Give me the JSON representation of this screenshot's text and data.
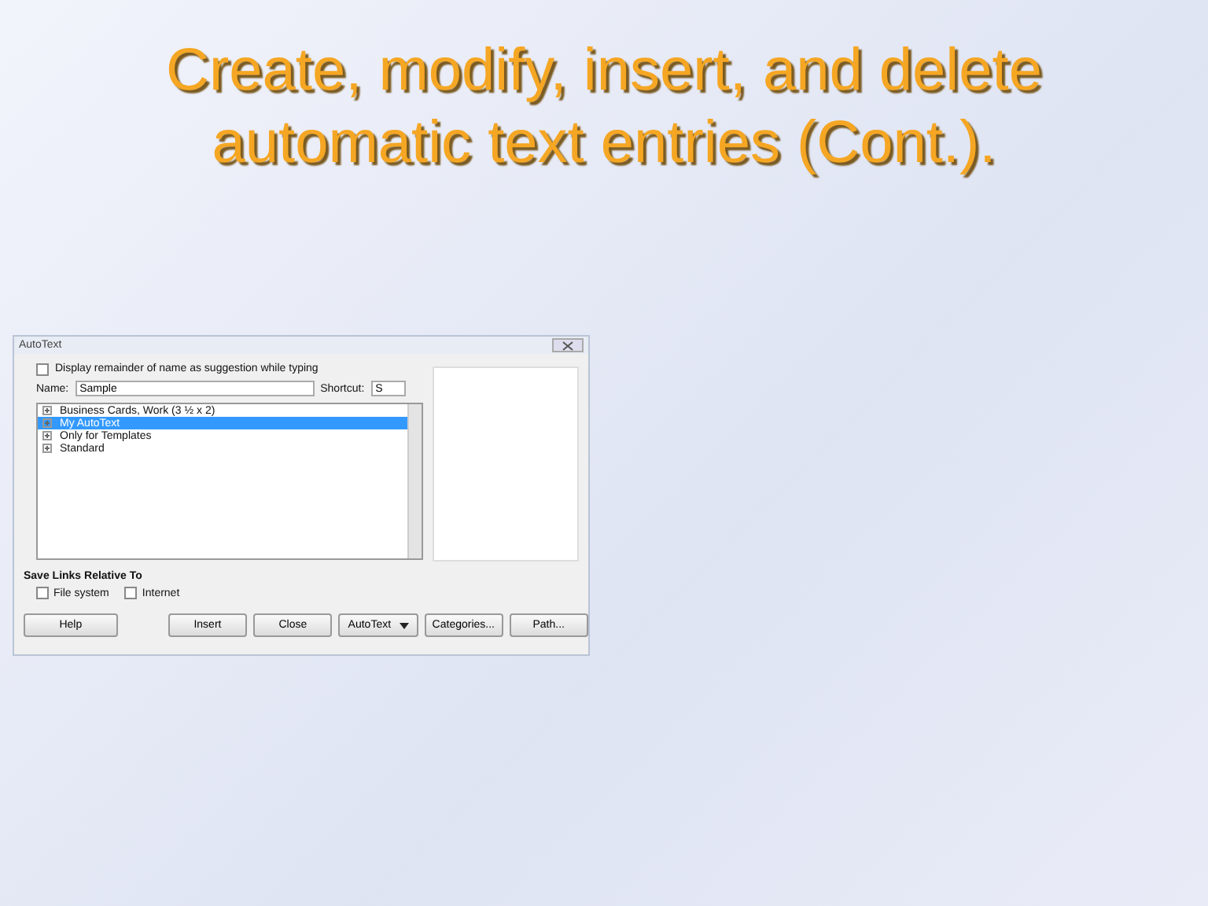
{
  "slide": {
    "title": "Create, modify, insert, and delete automatic text entries (Cont.)."
  },
  "dialog": {
    "title": "AutoText",
    "suggestion_checkbox": {
      "label": "Display remainder of name as suggestion while typing",
      "checked": false
    },
    "name_label": "Name:",
    "name_value": "Sample",
    "shortcut_label": "Shortcut:",
    "shortcut_value": "S",
    "categories": [
      {
        "label": "Business Cards, Work (3 ½ x 2)",
        "expanded": false,
        "selected": false
      },
      {
        "label": "My AutoText",
        "expanded": false,
        "selected": true
      },
      {
        "label": "Only for Templates",
        "expanded": false,
        "selected": false
      },
      {
        "label": "Standard",
        "expanded": false,
        "selected": false
      }
    ],
    "save_links_heading": "Save Links Relative To",
    "save_links": [
      {
        "label": "File system",
        "checked": false
      },
      {
        "label": "Internet",
        "checked": false
      }
    ],
    "buttons": [
      {
        "label": "Help",
        "kind": "plain"
      },
      {
        "label": "Insert",
        "kind": "plain"
      },
      {
        "label": "Close",
        "kind": "plain"
      },
      {
        "label": "AutoText",
        "kind": "menu"
      },
      {
        "label": "Categories...",
        "kind": "plain"
      },
      {
        "label": "Path...",
        "kind": "plain"
      }
    ]
  }
}
